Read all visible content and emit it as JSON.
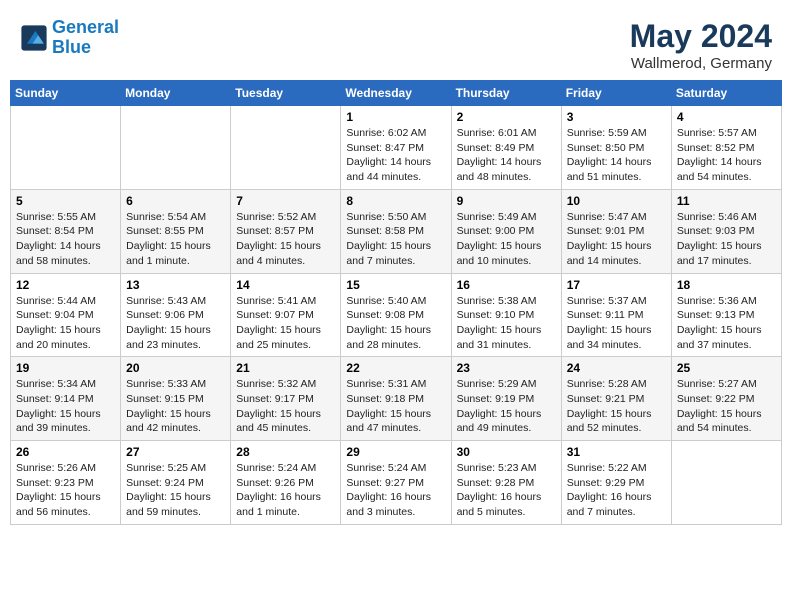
{
  "header": {
    "logo_line1": "General",
    "logo_line2": "Blue",
    "month_year": "May 2024",
    "location": "Wallmerod, Germany"
  },
  "weekdays": [
    "Sunday",
    "Monday",
    "Tuesday",
    "Wednesday",
    "Thursday",
    "Friday",
    "Saturday"
  ],
  "weeks": [
    [
      {
        "day": "",
        "info": ""
      },
      {
        "day": "",
        "info": ""
      },
      {
        "day": "",
        "info": ""
      },
      {
        "day": "1",
        "info": "Sunrise: 6:02 AM\nSunset: 8:47 PM\nDaylight: 14 hours\nand 44 minutes."
      },
      {
        "day": "2",
        "info": "Sunrise: 6:01 AM\nSunset: 8:49 PM\nDaylight: 14 hours\nand 48 minutes."
      },
      {
        "day": "3",
        "info": "Sunrise: 5:59 AM\nSunset: 8:50 PM\nDaylight: 14 hours\nand 51 minutes."
      },
      {
        "day": "4",
        "info": "Sunrise: 5:57 AM\nSunset: 8:52 PM\nDaylight: 14 hours\nand 54 minutes."
      }
    ],
    [
      {
        "day": "5",
        "info": "Sunrise: 5:55 AM\nSunset: 8:54 PM\nDaylight: 14 hours\nand 58 minutes."
      },
      {
        "day": "6",
        "info": "Sunrise: 5:54 AM\nSunset: 8:55 PM\nDaylight: 15 hours\nand 1 minute."
      },
      {
        "day": "7",
        "info": "Sunrise: 5:52 AM\nSunset: 8:57 PM\nDaylight: 15 hours\nand 4 minutes."
      },
      {
        "day": "8",
        "info": "Sunrise: 5:50 AM\nSunset: 8:58 PM\nDaylight: 15 hours\nand 7 minutes."
      },
      {
        "day": "9",
        "info": "Sunrise: 5:49 AM\nSunset: 9:00 PM\nDaylight: 15 hours\nand 10 minutes."
      },
      {
        "day": "10",
        "info": "Sunrise: 5:47 AM\nSunset: 9:01 PM\nDaylight: 15 hours\nand 14 minutes."
      },
      {
        "day": "11",
        "info": "Sunrise: 5:46 AM\nSunset: 9:03 PM\nDaylight: 15 hours\nand 17 minutes."
      }
    ],
    [
      {
        "day": "12",
        "info": "Sunrise: 5:44 AM\nSunset: 9:04 PM\nDaylight: 15 hours\nand 20 minutes."
      },
      {
        "day": "13",
        "info": "Sunrise: 5:43 AM\nSunset: 9:06 PM\nDaylight: 15 hours\nand 23 minutes."
      },
      {
        "day": "14",
        "info": "Sunrise: 5:41 AM\nSunset: 9:07 PM\nDaylight: 15 hours\nand 25 minutes."
      },
      {
        "day": "15",
        "info": "Sunrise: 5:40 AM\nSunset: 9:08 PM\nDaylight: 15 hours\nand 28 minutes."
      },
      {
        "day": "16",
        "info": "Sunrise: 5:38 AM\nSunset: 9:10 PM\nDaylight: 15 hours\nand 31 minutes."
      },
      {
        "day": "17",
        "info": "Sunrise: 5:37 AM\nSunset: 9:11 PM\nDaylight: 15 hours\nand 34 minutes."
      },
      {
        "day": "18",
        "info": "Sunrise: 5:36 AM\nSunset: 9:13 PM\nDaylight: 15 hours\nand 37 minutes."
      }
    ],
    [
      {
        "day": "19",
        "info": "Sunrise: 5:34 AM\nSunset: 9:14 PM\nDaylight: 15 hours\nand 39 minutes."
      },
      {
        "day": "20",
        "info": "Sunrise: 5:33 AM\nSunset: 9:15 PM\nDaylight: 15 hours\nand 42 minutes."
      },
      {
        "day": "21",
        "info": "Sunrise: 5:32 AM\nSunset: 9:17 PM\nDaylight: 15 hours\nand 45 minutes."
      },
      {
        "day": "22",
        "info": "Sunrise: 5:31 AM\nSunset: 9:18 PM\nDaylight: 15 hours\nand 47 minutes."
      },
      {
        "day": "23",
        "info": "Sunrise: 5:29 AM\nSunset: 9:19 PM\nDaylight: 15 hours\nand 49 minutes."
      },
      {
        "day": "24",
        "info": "Sunrise: 5:28 AM\nSunset: 9:21 PM\nDaylight: 15 hours\nand 52 minutes."
      },
      {
        "day": "25",
        "info": "Sunrise: 5:27 AM\nSunset: 9:22 PM\nDaylight: 15 hours\nand 54 minutes."
      }
    ],
    [
      {
        "day": "26",
        "info": "Sunrise: 5:26 AM\nSunset: 9:23 PM\nDaylight: 15 hours\nand 56 minutes."
      },
      {
        "day": "27",
        "info": "Sunrise: 5:25 AM\nSunset: 9:24 PM\nDaylight: 15 hours\nand 59 minutes."
      },
      {
        "day": "28",
        "info": "Sunrise: 5:24 AM\nSunset: 9:26 PM\nDaylight: 16 hours\nand 1 minute."
      },
      {
        "day": "29",
        "info": "Sunrise: 5:24 AM\nSunset: 9:27 PM\nDaylight: 16 hours\nand 3 minutes."
      },
      {
        "day": "30",
        "info": "Sunrise: 5:23 AM\nSunset: 9:28 PM\nDaylight: 16 hours\nand 5 minutes."
      },
      {
        "day": "31",
        "info": "Sunrise: 5:22 AM\nSunset: 9:29 PM\nDaylight: 16 hours\nand 7 minutes."
      },
      {
        "day": "",
        "info": ""
      }
    ]
  ]
}
